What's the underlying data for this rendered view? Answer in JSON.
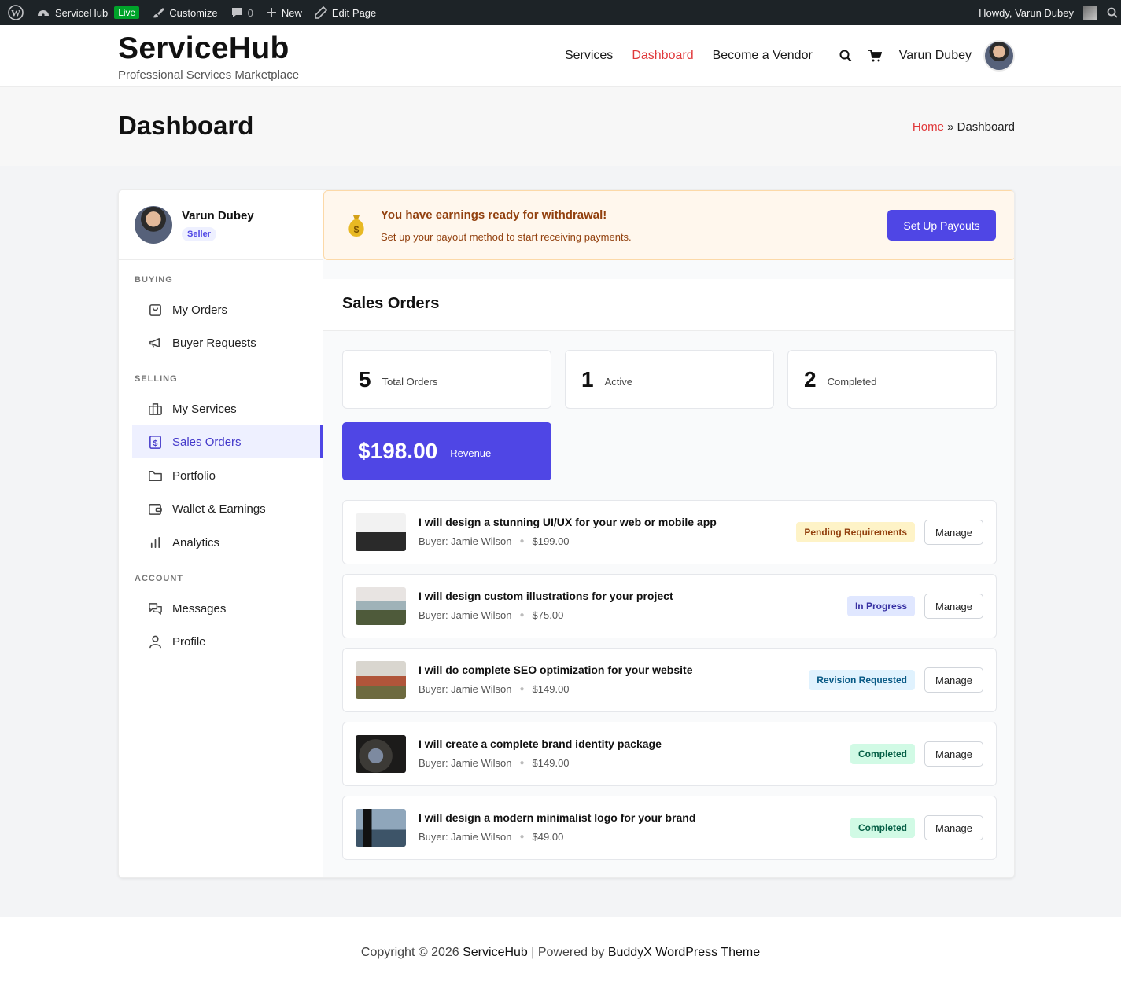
{
  "adminbar": {
    "site_name": "ServiceHub",
    "live_badge": "Live",
    "customize": "Customize",
    "comments_count": "0",
    "new": "New",
    "edit_page": "Edit Page",
    "howdy": "Howdy, Varun Dubey"
  },
  "header": {
    "site_title": "ServiceHub",
    "tagline": "Professional Services Marketplace",
    "nav": [
      "Services",
      "Dashboard",
      "Become a Vendor"
    ],
    "user_name": "Varun Dubey"
  },
  "titlebar": {
    "title": "Dashboard",
    "breadcrumb_home": "Home",
    "breadcrumb_sep": "»",
    "breadcrumb_current": "Dashboard"
  },
  "sidebar": {
    "user_name": "Varun Dubey",
    "role_badge": "Seller",
    "sections": {
      "buying": "BUYING",
      "selling": "SELLING",
      "account": "ACCOUNT"
    },
    "items": {
      "my_orders": "My Orders",
      "buyer_requests": "Buyer Requests",
      "my_services": "My Services",
      "sales_orders": "Sales Orders",
      "portfolio": "Portfolio",
      "wallet": "Wallet & Earnings",
      "analytics": "Analytics",
      "messages": "Messages",
      "profile": "Profile"
    }
  },
  "payout": {
    "icon": "money-bag-icon",
    "title": "You have earnings ready for withdrawal!",
    "description": "Set up your payout method to start receiving payments.",
    "button": "Set Up Payouts"
  },
  "sales": {
    "title": "Sales Orders",
    "stats": [
      {
        "value": "5",
        "label": "Total Orders"
      },
      {
        "value": "1",
        "label": "Active"
      },
      {
        "value": "2",
        "label": "Completed"
      }
    ],
    "revenue": {
      "value": "$198.00",
      "label": "Revenue"
    },
    "manage_label": "Manage",
    "orders": [
      {
        "title": "I will design a stunning UI/UX for your web or mobile app",
        "buyer": "Buyer: Jamie Wilson",
        "price": "$199.00",
        "status": "Pending Requirements"
      },
      {
        "title": "I will design custom illustrations for your project",
        "buyer": "Buyer: Jamie Wilson",
        "price": "$75.00",
        "status": "In Progress"
      },
      {
        "title": "I will do complete SEO optimization for your website",
        "buyer": "Buyer: Jamie Wilson",
        "price": "$149.00",
        "status": "Revision Requested"
      },
      {
        "title": "I will create a complete brand identity package",
        "buyer": "Buyer: Jamie Wilson",
        "price": "$149.00",
        "status": "Completed"
      },
      {
        "title": "I will design a modern minimalist logo for your brand",
        "buyer": "Buyer: Jamie Wilson",
        "price": "$49.00",
        "status": "Completed"
      }
    ]
  },
  "footer": {
    "copyright": "Copyright © 2026",
    "site_link": "ServiceHub",
    "separator": "| Powered by",
    "theme_link": "BuddyX WordPress Theme"
  },
  "colors": {
    "accent": "#4f46e5",
    "nav_active": "#e0383a",
    "admin_bar": "#1d2327"
  }
}
